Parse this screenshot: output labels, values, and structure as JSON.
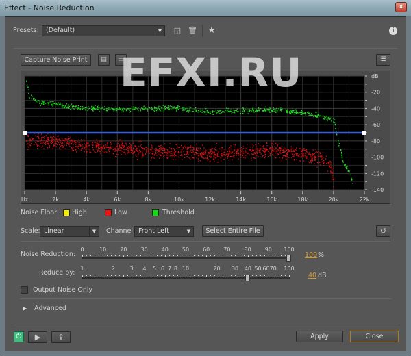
{
  "window": {
    "title": "Effect - Noise Reduction",
    "close": "x"
  },
  "presets": {
    "label": "Presets:",
    "value": "(Default)"
  },
  "capture_label": "Capture Noise Print",
  "watermark": "EFXI.RU",
  "chart_data": {
    "type": "scatter",
    "ylabel": "dB",
    "x_ticks": [
      "Hz",
      "2k",
      "4k",
      "6k",
      "8k",
      "10k",
      "12k",
      "14k",
      "16k",
      "18k",
      "20k",
      "22k"
    ],
    "xlim": [
      0,
      22000
    ],
    "y_ticks": [
      "dB",
      "-20",
      "-40",
      "-60",
      "-80",
      "-100",
      "-120",
      "-140"
    ],
    "ylim": [
      -140,
      0
    ],
    "grid": true,
    "threshold_db": -70,
    "series": [
      {
        "name": "Threshold",
        "color": "#22dd22",
        "points": [
          [
            100,
            -5
          ],
          [
            300,
            -25
          ],
          [
            1000,
            -33
          ],
          [
            2000,
            -33
          ],
          [
            3000,
            -38
          ],
          [
            6000,
            -41
          ],
          [
            10000,
            -39
          ],
          [
            12000,
            -44
          ],
          [
            16000,
            -41
          ],
          [
            18000,
            -45
          ],
          [
            19800,
            -52
          ],
          [
            20000,
            -55
          ],
          [
            20300,
            -80
          ],
          [
            20600,
            -105
          ],
          [
            21000,
            -118
          ],
          [
            21300,
            -135
          ]
        ]
      },
      {
        "name": "Low",
        "color": "#dd1111",
        "points": [
          [
            100,
            -80
          ],
          [
            2000,
            -80
          ],
          [
            4000,
            -86
          ],
          [
            8000,
            -92
          ],
          [
            12000,
            -95
          ],
          [
            16000,
            -91
          ],
          [
            18000,
            -96
          ],
          [
            19500,
            -102
          ],
          [
            19800,
            -110
          ],
          [
            20000,
            -130
          ]
        ]
      }
    ]
  },
  "legend": {
    "label": "Noise Floor:",
    "items": [
      {
        "name": "High",
        "color": "#f0f000"
      },
      {
        "name": "Low",
        "color": "#ee1111"
      },
      {
        "name": "Threshold",
        "color": "#11dd11"
      }
    ]
  },
  "scale": {
    "label": "Scale:",
    "value": "Linear"
  },
  "channel": {
    "label": "Channel:",
    "value": "Front Left"
  },
  "select_entire_file": "Select Entire File",
  "noise_reduction": {
    "label": "Noise Reduction:",
    "ticks": [
      "0",
      "10",
      "20",
      "30",
      "40",
      "50",
      "60",
      "70",
      "80",
      "90",
      "100"
    ],
    "value": "100",
    "unit": "%",
    "percent": 100
  },
  "reduce_by": {
    "label": "Reduce by:",
    "ticks": [
      "1",
      "2",
      "3",
      "4",
      "5",
      "6",
      "7",
      "8",
      "10",
      "20",
      "30",
      "40",
      "50",
      "60",
      "70",
      "100"
    ],
    "value": "40",
    "unit": "dB"
  },
  "output_noise_only": {
    "label": "Output Noise Only",
    "checked": false
  },
  "advanced": "Advanced",
  "apply": "Apply",
  "close": "Close"
}
